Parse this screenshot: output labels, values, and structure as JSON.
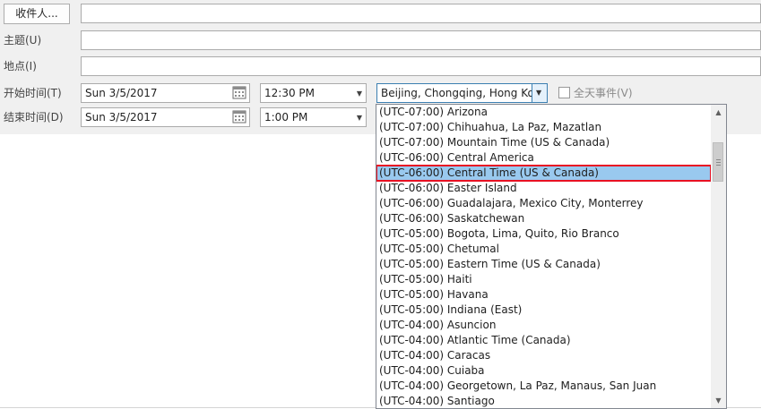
{
  "recipients_button": "收件人...",
  "subject_label": "主题(U)",
  "location_label": "地点(I)",
  "start_label": "开始时间(T)",
  "end_label": "结束时间(D)",
  "start_date": "Sun 3/5/2017",
  "start_time": "12:30 PM",
  "end_date": "Sun 3/5/2017",
  "end_time": "1:00 PM",
  "timezone_value": "Beijing, Chongqing, Hong Kong",
  "allday_label": "全天事件(V)",
  "timezone_options": [
    "(UTC-07:00) Arizona",
    "(UTC-07:00) Chihuahua, La Paz, Mazatlan",
    "(UTC-07:00) Mountain Time (US & Canada)",
    "(UTC-06:00) Central America",
    "(UTC-06:00) Central Time (US & Canada)",
    "(UTC-06:00) Easter Island",
    "(UTC-06:00) Guadalajara, Mexico City, Monterrey",
    "(UTC-06:00) Saskatchewan",
    "(UTC-05:00) Bogota, Lima, Quito, Rio Branco",
    "(UTC-05:00) Chetumal",
    "(UTC-05:00) Eastern Time (US & Canada)",
    "(UTC-05:00) Haiti",
    "(UTC-05:00) Havana",
    "(UTC-05:00) Indiana (East)",
    "(UTC-04:00) Asuncion",
    "(UTC-04:00) Atlantic Time (Canada)",
    "(UTC-04:00) Caracas",
    "(UTC-04:00) Cuiaba",
    "(UTC-04:00) Georgetown, La Paz, Manaus, San Juan",
    "(UTC-04:00) Santiago"
  ],
  "selected_index": 4,
  "colors": {
    "selection": "#99c9ef",
    "highlight_border": "#e81123",
    "focus_border": "#3c7fb1"
  }
}
